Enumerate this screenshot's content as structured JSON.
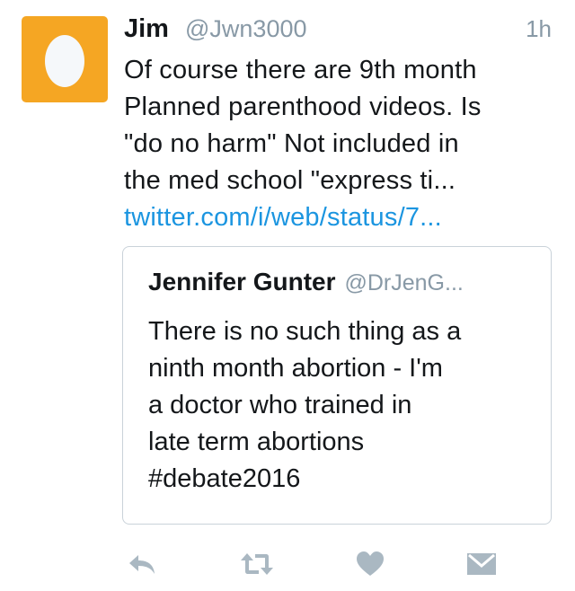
{
  "tweet": {
    "author_name": "Jim",
    "author_handle": "@Jwn3000",
    "timestamp": "1h",
    "text_lines": [
      "Of course there are 9th month",
      "Planned parenthood videos. Is",
      "\"do no harm\" Not included in",
      "the med school \"express ti..."
    ],
    "link_text": "twitter.com/i/web/status/7...",
    "avatar_color": "#f5a623",
    "avatar_icon": "egg-icon"
  },
  "quoted_tweet": {
    "author_name": "Jennifer Gunter",
    "author_handle": "@DrJenG...",
    "text_lines": [
      "There is no such thing as a",
      "ninth month abortion - I'm",
      "a doctor who trained in",
      "late term abortions",
      "#debate2016"
    ]
  },
  "actions": [
    {
      "name": "reply",
      "icon": "reply-icon"
    },
    {
      "name": "retweet",
      "icon": "retweet-icon"
    },
    {
      "name": "like",
      "icon": "heart-icon"
    },
    {
      "name": "message",
      "icon": "envelope-icon"
    }
  ],
  "colors": {
    "link": "#1b95e0",
    "muted": "#8899a6",
    "icon": "#aab8c2",
    "border": "#c9d2d9"
  }
}
